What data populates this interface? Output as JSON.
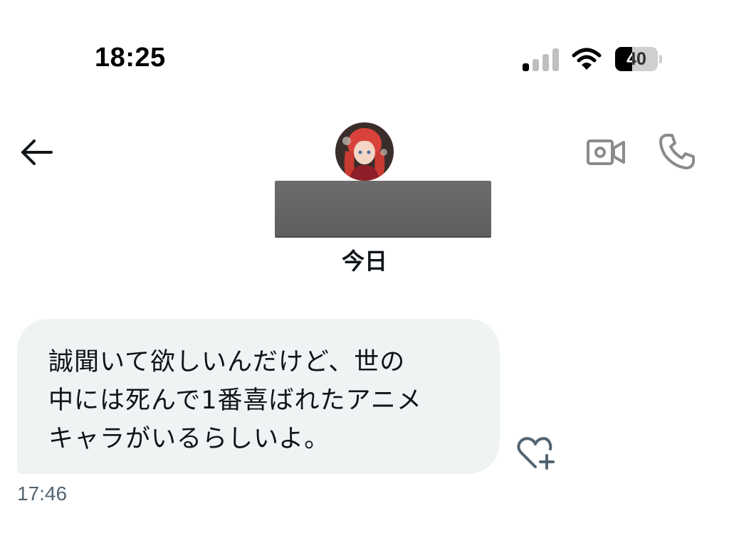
{
  "status_bar": {
    "time": "18:25",
    "battery_percent": "40",
    "battery_level": 0.4,
    "signal_bars_active": 1,
    "signal_bars_total": 4
  },
  "header": {
    "back_icon": "arrow-left-icon",
    "video_icon": "video-camera-icon",
    "phone_icon": "phone-icon"
  },
  "conversation": {
    "date_label": "今日",
    "messages": [
      {
        "text": "誠聞いて欲しいんだけど、世の\n中には死んで1番喜ばれたアニメ\nキャラがいるらしいよ。",
        "time": "17:46"
      }
    ]
  },
  "colors": {
    "bubble_bg": "#eff3f4",
    "text": "#0f1419",
    "muted": "#536471",
    "icon_gray": "#8b8b8b"
  }
}
